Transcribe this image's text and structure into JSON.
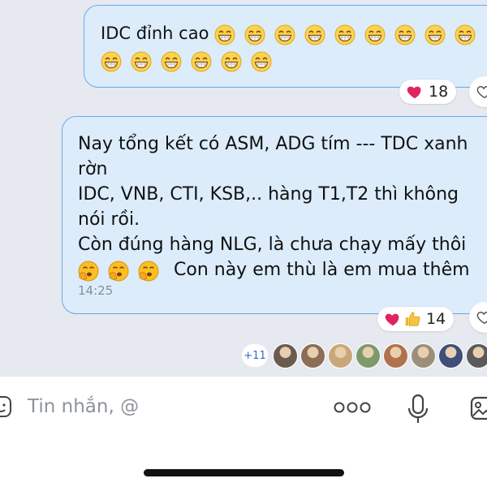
{
  "messages": [
    {
      "text": "IDC đỉnh cao",
      "emoji": "grinning-face",
      "emoji_count_line1": 9,
      "emoji_count_line2": 6,
      "reactions": {
        "icons": [
          "heart"
        ],
        "count": "18"
      }
    },
    {
      "lines": [
        "Nay tổng kết có ASM, ADG tím --- TDC xanh",
        "rờn",
        "IDC, VNB, CTI, KSB,.. hàng T1,T2 thì không",
        "nói rồi.",
        "Còn đúng hàng NLG, là chưa chạy mấy thôi"
      ],
      "last_line_text": "Con này em thù là em mua thêm",
      "emoji": "thinking-yawning-face",
      "emoji_count": 3,
      "time": "14:25",
      "reactions": {
        "icons": [
          "heart",
          "thumbs-up"
        ],
        "count": "14"
      }
    }
  ],
  "seen": {
    "extra_label": "+11",
    "avatar_colors": [
      "#6b5a4e",
      "#8a6e55",
      "#c9a77a",
      "#7d9a6a",
      "#b0724e",
      "#9c8f7a",
      "#3d4f7a",
      "#5a5a5a"
    ]
  },
  "composer": {
    "placeholder": "Tin nhắn, @",
    "icons": [
      "sticker-icon",
      "more-dots-icon",
      "microphone-icon",
      "image-icon"
    ]
  },
  "colors": {
    "bubble_bg": "#dcecfb",
    "bubble_border": "#6aa8ec",
    "chat_bg": "#e6e9ef",
    "heart": "#e0245e",
    "accent": "#2b6fd6"
  }
}
